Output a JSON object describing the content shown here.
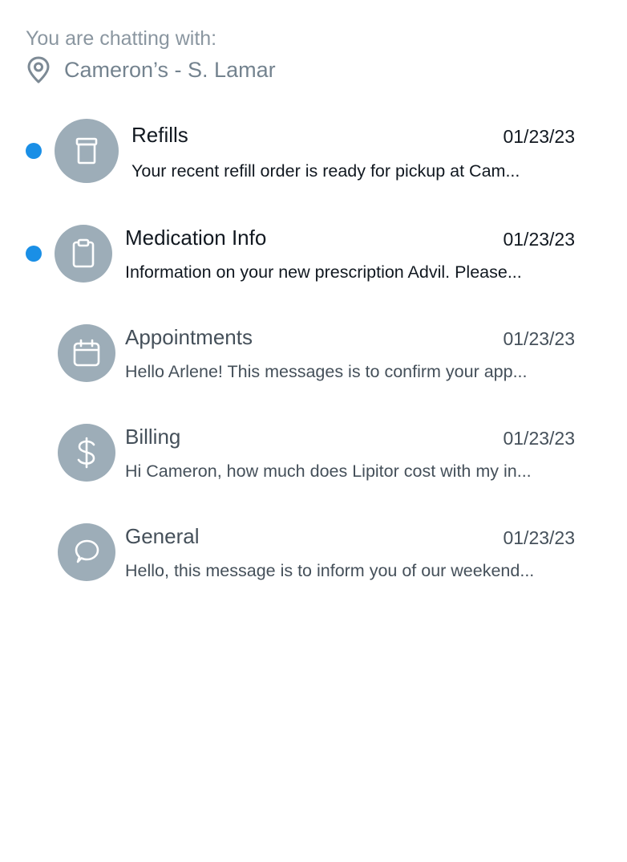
{
  "header": {
    "chatting_label": "You are chatting with:",
    "location_icon": "map-pin-icon",
    "location_name": "Cameron’s - S. Lamar"
  },
  "threads": [
    {
      "title": "Refills",
      "date": "01/23/23",
      "preview": "Your recent refill order is ready for pickup at Cam...",
      "unread": true,
      "icon": "pill-bottle-icon"
    },
    {
      "title": "Medication Info",
      "date": "01/23/23",
      "preview": "Information on your new prescription Advil. Please...",
      "unread": true,
      "icon": "clipboard-icon"
    },
    {
      "title": "Appointments",
      "date": "01/23/23",
      "preview": "Hello Arlene! This messages is to confirm your app...",
      "unread": false,
      "icon": "calendar-icon"
    },
    {
      "title": "Billing",
      "date": "01/23/23",
      "preview": "Hi Cameron, how much does Lipitor cost with my in...",
      "unread": false,
      "icon": "dollar-icon"
    },
    {
      "title": "General",
      "date": "01/23/23",
      "preview": "Hello, this message is to inform you of our weekend...",
      "unread": false,
      "icon": "chat-bubble-icon"
    }
  ],
  "colors": {
    "unread_dot": "#1a8fe6",
    "avatar_bg": "#9dadb8",
    "header_text": "#8a96a0"
  }
}
